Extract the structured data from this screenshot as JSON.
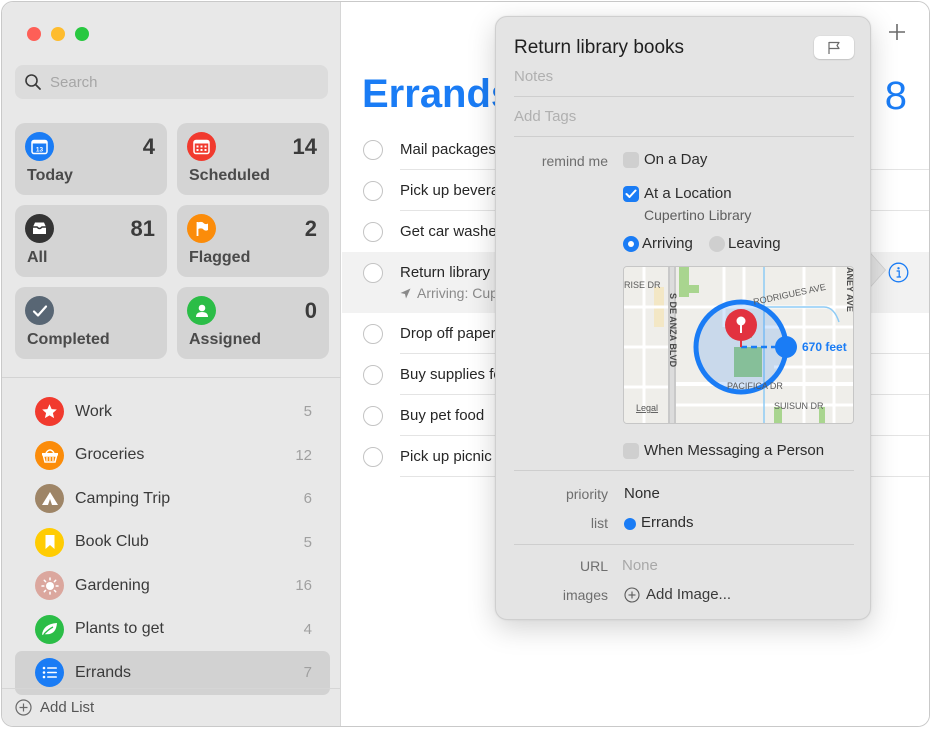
{
  "window": {
    "traffic_lights": [
      "close",
      "minimize",
      "zoom"
    ]
  },
  "sidebar": {
    "search": {
      "placeholder": "Search",
      "value": ""
    },
    "smart_lists": [
      {
        "label": "Today",
        "count": "4",
        "icon": "calendar-today-icon",
        "color": "#1a7cf5",
        "day": "13"
      },
      {
        "label": "Scheduled",
        "count": "14",
        "icon": "calendar-grid-icon",
        "color": "#f13a2e"
      },
      {
        "label": "All",
        "count": "81",
        "icon": "tray-icon",
        "color": "#333333"
      },
      {
        "label": "Flagged",
        "count": "2",
        "icon": "flag-icon",
        "color": "#fb8c0a"
      },
      {
        "label": "Completed",
        "count": "",
        "icon": "checkmark-icon",
        "color": "#586674"
      },
      {
        "label": "Assigned",
        "count": "0",
        "icon": "person-icon",
        "color": "#2bbd47"
      }
    ],
    "lists": [
      {
        "name": "Work",
        "count": "5",
        "icon": "star-icon",
        "color": "#f13a2e"
      },
      {
        "name": "Groceries",
        "count": "12",
        "icon": "basket-icon",
        "color": "#fb8c0a"
      },
      {
        "name": "Camping Trip",
        "count": "6",
        "icon": "tent-icon",
        "color": "#9e8567"
      },
      {
        "name": "Book Club",
        "count": "5",
        "icon": "bookmark-icon",
        "color": "#ffcc02"
      },
      {
        "name": "Gardening",
        "count": "16",
        "icon": "sun-icon",
        "color": "#dba79e"
      },
      {
        "name": "Plants to get",
        "count": "4",
        "icon": "leaf-icon",
        "color": "#2bbd47"
      },
      {
        "name": "Errands",
        "count": "7",
        "icon": "list-bullet-icon",
        "color": "#1a7cf5",
        "selected": true
      }
    ],
    "add_list_label": "Add List"
  },
  "main": {
    "title": "Errands",
    "count": "8",
    "accent": "#1a7cf5",
    "reminders": [
      {
        "text": "Mail packages"
      },
      {
        "text": "Pick up beverages"
      },
      {
        "text": "Get car washed"
      },
      {
        "text": "Return library books",
        "subtitle": "Arriving: Cupertino Library",
        "selected": true
      },
      {
        "text": "Drop off paperwork"
      },
      {
        "text": "Buy supplies for"
      },
      {
        "text": "Buy pet food"
      },
      {
        "text": "Pick up picnic"
      }
    ]
  },
  "detail": {
    "title": "Return library books",
    "notes_placeholder": "Notes",
    "tags_placeholder": "Add Tags",
    "remind_me_label": "remind me",
    "on_a_day": {
      "label": "On a Day",
      "checked": false
    },
    "at_a_location": {
      "label": "At a Location",
      "checked": true,
      "place": "Cupertino Library"
    },
    "arriving": {
      "label": "Arriving",
      "selected": true
    },
    "leaving": {
      "label": "Leaving",
      "selected": false
    },
    "map": {
      "streets": [
        "RISE DR",
        "S DE ANZA BLVD",
        "RODRIGUES AVE",
        "ANEY AVE",
        "PACIFICA DR",
        "SUISUN DR"
      ],
      "radius_label": "670 feet",
      "legal_label": "Legal"
    },
    "when_messaging": {
      "label": "When Messaging a Person",
      "checked": false
    },
    "priority_label": "priority",
    "priority_value": "None",
    "list_label": "list",
    "list_value": "Errands",
    "list_color": "#1a7cf5",
    "url_label": "URL",
    "url_value": "None",
    "images_label": "images",
    "add_image_label": "Add Image..."
  }
}
